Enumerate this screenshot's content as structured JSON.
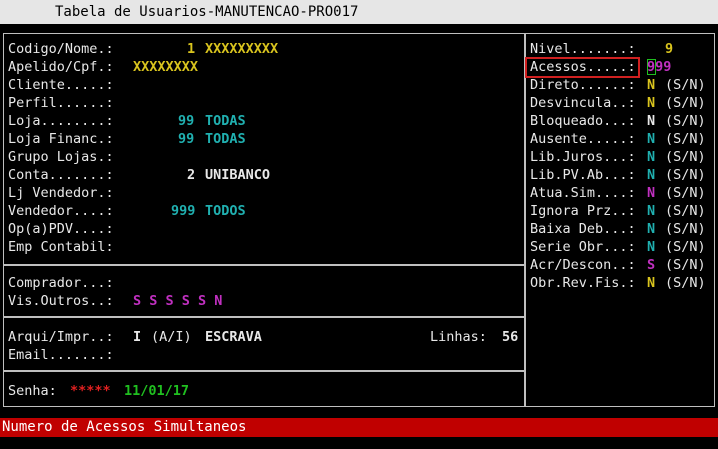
{
  "window": {
    "title": "Tabela de Usuarios-MANUTENCAO-PRO017"
  },
  "left": {
    "codigo_label": "Codigo/Nome.:",
    "codigo_num": "1",
    "codigo_name": "XXXXXXXXX",
    "apelido_label": "Apelido/Cpf.:",
    "apelido_value": "XXXXXXXX",
    "cliente_label": "Cliente.....:",
    "perfil_label": "Perfil......:",
    "loja_label": "Loja........:",
    "loja_num": "99",
    "loja_name": "TODAS",
    "lojafin_label": "Loja Financ.:",
    "lojafin_num": "99",
    "lojafin_name": "TODAS",
    "grupo_label": "Grupo Lojas.:",
    "conta_label": "Conta.......:",
    "conta_num": "2",
    "conta_name": "UNIBANCO",
    "ljvend_label": "Lj Vendedor.:",
    "vendedor_label": "Vendedor....:",
    "vendedor_num": "999",
    "vendedor_name": "TODOS",
    "pdv_label": "Op(a)PDV....:",
    "emp_label": "Emp Contabil:",
    "comprador_label": "Comprador...:",
    "visoutros_label": "Vis.Outros..:",
    "visoutros_value": "S S S S S N",
    "arqui_label": "Arqui/Impr..:",
    "arqui_value": "I",
    "arqui_hint": "(A/I)",
    "arqui_name": "ESCRAVA",
    "linhas_label": "Linhas:",
    "linhas_value": "56",
    "email_label": "Email.......:",
    "senha_label": "Senha:",
    "senha_value": "*****",
    "senha_date": "11/01/17"
  },
  "right": {
    "nivel_label": "Nivel.......:",
    "nivel_value": "9",
    "acessos_label": "Acessos.....:",
    "acessos_value": "999",
    "flags": [
      {
        "label": "Direto......:",
        "value": "N",
        "hint": "(S/N)",
        "color": "#d9c41e"
      },
      {
        "label": "Desvincula..:",
        "value": "N",
        "hint": "(S/N)",
        "color": "#d9c41e"
      },
      {
        "label": "Bloqueado...:",
        "value": "N",
        "hint": "(S/N)",
        "color": "#e8e8e8"
      },
      {
        "label": "Ausente.....:",
        "value": "N",
        "hint": "(S/N)",
        "color": "#20b0b0"
      },
      {
        "label": "Lib.Juros...:",
        "value": "N",
        "hint": "(S/N)",
        "color": "#20b0b0"
      },
      {
        "label": "Lib.PV.Ab...:",
        "value": "N",
        "hint": "(S/N)",
        "color": "#20b0b0"
      },
      {
        "label": "Atua.Sim....:",
        "value": "N",
        "hint": "(S/N)",
        "color": "#c030c0"
      },
      {
        "label": "Ignora Prz..:",
        "value": "N",
        "hint": "(S/N)",
        "color": "#20b0b0"
      },
      {
        "label": "Baixa Deb...:",
        "value": "N",
        "hint": "(S/N)",
        "color": "#20b0b0"
      },
      {
        "label": "Serie Obr...:",
        "value": "N",
        "hint": "(S/N)",
        "color": "#20b0b0"
      },
      {
        "label": "Acr/Descon..:",
        "value": "S",
        "hint": "(S/N)",
        "color": "#c030c0"
      },
      {
        "label": "Obr.Rev.Fis.:",
        "value": "N",
        "hint": "(S/N)",
        "color": "#d9c41e"
      }
    ]
  },
  "status": {
    "message": "Numero de Acessos Simultaneos"
  }
}
